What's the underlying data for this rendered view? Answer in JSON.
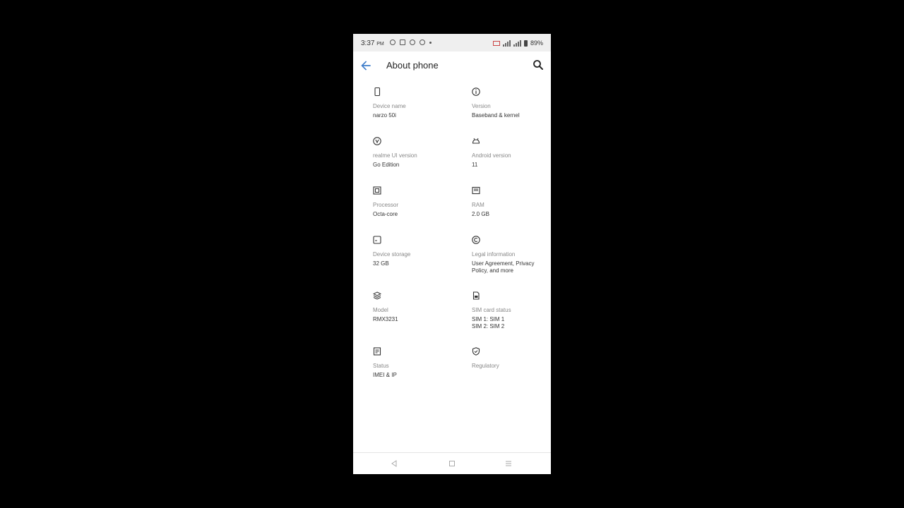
{
  "status_bar": {
    "time": "3:37",
    "time_suffix": "PM",
    "battery": "89%"
  },
  "app_bar": {
    "title": "About phone",
    "back_icon": "arrow-back-icon",
    "search_icon": "search-icon"
  },
  "items": [
    {
      "icon": "phone-icon",
      "label": "Device name",
      "value": "narzo 50i"
    },
    {
      "icon": "info-icon",
      "label": "Version",
      "value": "Baseband & kernel"
    },
    {
      "icon": "realme-ui-icon",
      "label": "realme UI version",
      "value": "Go Edition"
    },
    {
      "icon": "android-icon",
      "label": "Android version",
      "value": "11"
    },
    {
      "icon": "processor-icon",
      "label": "Processor",
      "value": "Octa-core"
    },
    {
      "icon": "ram-icon",
      "label": "RAM",
      "value": "2.0 GB"
    },
    {
      "icon": "storage-icon",
      "label": "Device storage",
      "value": "32 GB"
    },
    {
      "icon": "copyright-icon",
      "label": "Legal information",
      "value": "User Agreement, Privacy Policy, and more"
    },
    {
      "icon": "layers-icon",
      "label": "Model",
      "value": "RMX3231"
    },
    {
      "icon": "sim-icon",
      "label": "SIM card status",
      "value_line1": "SIM 1: SIM 1",
      "value_line2": "SIM 2: SIM 2"
    },
    {
      "icon": "document-icon",
      "label": "Status",
      "value": "IMEI & IP"
    },
    {
      "icon": "shield-check-icon",
      "label": "Regulatory",
      "value": ""
    }
  ],
  "nav_bar": {
    "back": "nav-back-icon",
    "home": "nav-home-icon",
    "recents": "nav-recents-icon"
  },
  "colors": {
    "accent": "#3d7cc9",
    "text_primary": "#333333",
    "text_secondary": "#888888"
  }
}
